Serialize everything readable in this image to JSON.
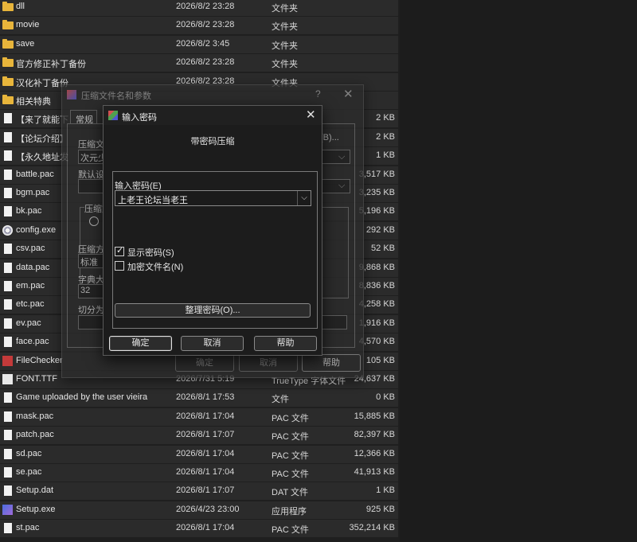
{
  "files": [
    {
      "name": "dll",
      "date": "2026/8/2 23:28",
      "type": "文件夹",
      "size": "",
      "icon": "folder-icon"
    },
    {
      "name": "movie",
      "date": "2026/8/2 23:28",
      "type": "文件夹",
      "size": "",
      "icon": "folder-icon"
    },
    {
      "name": "save",
      "date": "2026/8/2 3:45",
      "type": "文件夹",
      "size": "",
      "icon": "folder-icon"
    },
    {
      "name": "官方修正补丁备份",
      "date": "2026/8/2 23:28",
      "type": "文件夹",
      "size": "",
      "icon": "folder-icon"
    },
    {
      "name": "汉化补丁备份",
      "date": "2026/8/2 23:28",
      "type": "文件夹",
      "size": "",
      "icon": "folder-icon"
    },
    {
      "name": "相关特典",
      "date": "",
      "type": "",
      "size": "",
      "icon": "folder-icon"
    },
    {
      "name": "【来了就能下",
      "date": "",
      "type": "",
      "size": "2 KB",
      "icon": "document-icon"
    },
    {
      "name": "【论坛介绍】",
      "date": "",
      "type": "",
      "size": "2 KB",
      "icon": "document-icon"
    },
    {
      "name": "【永久地址发",
      "date": "",
      "type": "",
      "size": "1 KB",
      "icon": "document-icon"
    },
    {
      "name": "battle.pac",
      "date": "",
      "type": "",
      "size": "3,517 KB",
      "icon": "document-icon"
    },
    {
      "name": "bgm.pac",
      "date": "",
      "type": "",
      "size": "3,235 KB",
      "icon": "document-icon"
    },
    {
      "name": "bk.pac",
      "date": "",
      "type": "",
      "size": "5,196 KB",
      "icon": "document-icon"
    },
    {
      "name": "config.exe",
      "date": "",
      "type": "",
      "size": "292 KB",
      "icon": "exe-icon"
    },
    {
      "name": "csv.pac",
      "date": "",
      "type": "",
      "size": "52 KB",
      "icon": "document-icon"
    },
    {
      "name": "data.pac",
      "date": "",
      "type": "",
      "size": "9,868 KB",
      "icon": "document-icon"
    },
    {
      "name": "em.pac",
      "date": "",
      "type": "",
      "size": "8,836 KB",
      "icon": "document-icon"
    },
    {
      "name": "etc.pac",
      "date": "",
      "type": "",
      "size": "4,258 KB",
      "icon": "document-icon"
    },
    {
      "name": "ev.pac",
      "date": "",
      "type": "",
      "size": "1,916 KB",
      "icon": "document-icon"
    },
    {
      "name": "face.pac",
      "date": "",
      "type": "",
      "size": "4,570 KB",
      "icon": "document-icon"
    },
    {
      "name": "FileChecker",
      "date": "",
      "type": "",
      "size": "105 KB",
      "icon": "checker-icon"
    },
    {
      "name": "FONT.TTF",
      "date": "2026/7/31 5:19",
      "type": "TrueType 字体文件",
      "size": "24,637 KB",
      "icon": "font-icon"
    },
    {
      "name": "Game uploaded by the user vieira",
      "date": "2026/8/1 17:53",
      "type": "文件",
      "size": "0 KB",
      "icon": "document-icon"
    },
    {
      "name": "mask.pac",
      "date": "2026/8/1 17:04",
      "type": "PAC 文件",
      "size": "15,885 KB",
      "icon": "document-icon"
    },
    {
      "name": "patch.pac",
      "date": "2026/8/1 17:07",
      "type": "PAC 文件",
      "size": "82,397 KB",
      "icon": "document-icon"
    },
    {
      "name": "sd.pac",
      "date": "2026/8/1 17:04",
      "type": "PAC 文件",
      "size": "12,366 KB",
      "icon": "document-icon"
    },
    {
      "name": "se.pac",
      "date": "2026/8/1 17:04",
      "type": "PAC 文件",
      "size": "41,913 KB",
      "icon": "document-icon"
    },
    {
      "name": "Setup.dat",
      "date": "2026/8/1 17:07",
      "type": "DAT 文件",
      "size": "1 KB",
      "icon": "document-icon"
    },
    {
      "name": "Setup.exe",
      "date": "2026/4/23 23:00",
      "type": "应用程序",
      "size": "925 KB",
      "icon": "setup-icon"
    },
    {
      "name": "st.pac",
      "date": "2026/8/1 17:04",
      "type": "PAC 文件",
      "size": "352,214 KB",
      "icon": "document-icon"
    }
  ],
  "archive_dialog": {
    "title": "压缩文件名和参数",
    "help": "?",
    "close": "✕",
    "tab_general": "常规",
    "label_filename": "压缩文",
    "filename_value": "次元少",
    "browse_button": "(B)...",
    "label_default": "默认设",
    "label_format": "压缩文",
    "label_method": "压缩方",
    "method_value": "标准",
    "label_dict": "字典大",
    "dict_value": "32",
    "label_split": "切分为",
    "btn_ok": "确定",
    "btn_cancel": "取消",
    "btn_help": "帮助"
  },
  "password_dialog": {
    "title": "输入密码",
    "close": "✕",
    "subtitle": "带密码压缩",
    "password_label": "输入密码(E)",
    "password_value": "上老王论坛当老王",
    "show_password_label": "显示密码(S)",
    "show_password_checked": true,
    "encrypt_names_label": "加密文件名(N)",
    "encrypt_names_checked": false,
    "manage_button": "整理密码(O)...",
    "ok_button": "确定",
    "cancel_button": "取消",
    "help_button": "帮助"
  }
}
